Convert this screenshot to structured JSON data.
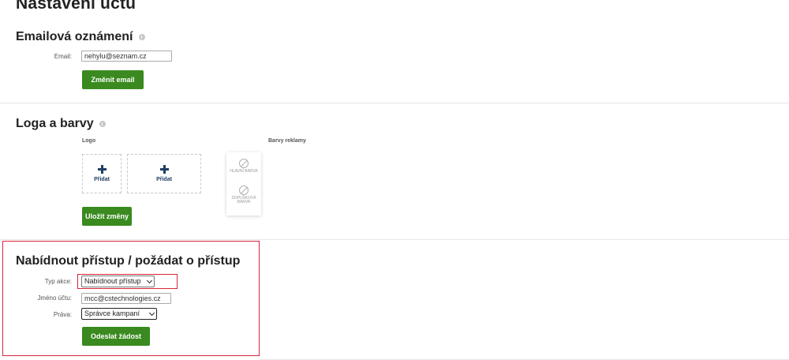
{
  "page": {
    "title": "Nastavení účtu"
  },
  "email_section": {
    "title": "Emailová oznámení",
    "email_label": "Email:",
    "email_value": "nehylu@seznam.cz",
    "change_button": "Změnit email"
  },
  "logos_section": {
    "title": "Loga a barvy",
    "logo_label": "Logo",
    "colors_label": "Barvy reklamy",
    "add_label_1": "Přidat",
    "add_label_2": "Přidat",
    "main_color": "HLAVNÍ BARVA",
    "secondary_color_line1": "DOPLŇKOVÁ",
    "secondary_color_line2": "BARVA",
    "save_button": "Uložit změny"
  },
  "access_section": {
    "title": "Nabídnout přístup / požádat o přístup",
    "action_type_label": "Typ akce:",
    "action_type_value": "Nabídnout přístup",
    "account_name_label": "Jméno účtu:",
    "account_name_value": "mcc@cstechnologies.cz",
    "rights_label": "Práva:",
    "rights_value": "Správce kampaní",
    "send_button": "Odeslat žádost"
  },
  "colors": {
    "accent_green": "#3a8a1f",
    "highlight_red": "#d9263b",
    "plus_blue": "#1f3f63"
  },
  "icons": [
    "info-icon",
    "plus-icon",
    "no-color-icon",
    "chevron-down-icon"
  ]
}
